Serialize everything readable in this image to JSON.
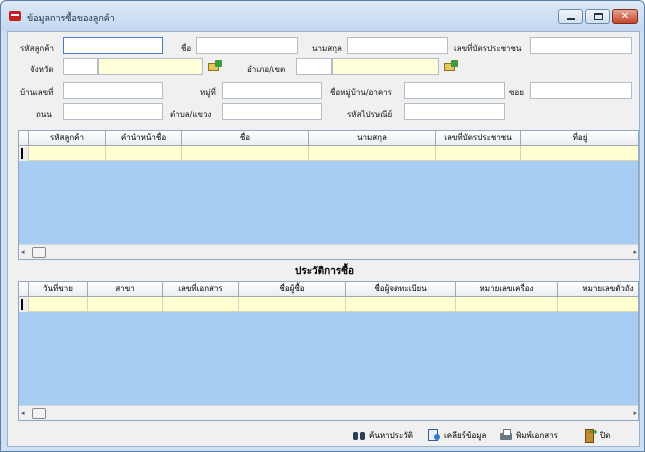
{
  "window": {
    "title": "ข้อมูลการซื้อของลูกค้า",
    "minimize_glyph": "",
    "maximize_glyph": "",
    "close_glyph": "✕"
  },
  "form": {
    "customer_code_label": "รหัสลูกค้า",
    "customer_code_value": "",
    "first_name_label": "ชื่อ",
    "first_name_value": "",
    "last_name_label": "นามสกุล",
    "last_name_value": "",
    "id_card_label": "เลขที่บัตรประชาชน",
    "id_card_value": "",
    "province_label": "จังหวัด",
    "province_code_value": "",
    "province_name_value": "",
    "district_label": "อำเภอ/เขต",
    "district_code_value": "",
    "district_name_value": "",
    "house_no_label": "บ้านเลขที่",
    "house_no_value": "",
    "moo_label": "หมู่ที่",
    "moo_value": "",
    "village_label": "ชื่อหมู่บ้าน/อาคาร",
    "village_value": "",
    "soi_label": "ซอย",
    "soi_value": "",
    "road_label": "ถนน",
    "road_value": "",
    "subdistrict_label": "ตำบล/แขวง",
    "subdistrict_value": "",
    "postcode_label": "รหัสไปรษณีย์",
    "postcode_value": ""
  },
  "customer_grid": {
    "columns": [
      "รหัสลูกค้า",
      "คำนำหน้าชื่อ",
      "ชื่อ",
      "นามสกุล",
      "เลขที่บัตรประชาชน",
      "ที่อยู่"
    ]
  },
  "history": {
    "title": "ประวัติการซื้อ",
    "columns": [
      "วันที่ขาย",
      "สาขา",
      "เลขที่เอกสาร",
      "ชื่อผู้ซื้อ",
      "ชื่อผู้จดทะเบียน",
      "หมายเลขเครื่อง",
      "หมายเลขตัวถัง"
    ]
  },
  "toolbar": {
    "search_history_label": "ค้นหาประวัติ",
    "clear_label": "เคลียร์ข้อมูล",
    "print_label": "พิมพ์เอกสาร",
    "close_label": "ปิด"
  },
  "colors": {
    "grid_background": "#a7cdf3",
    "grid_selected_row": "#ffffd2",
    "window_frame": "#cfe0f3"
  }
}
